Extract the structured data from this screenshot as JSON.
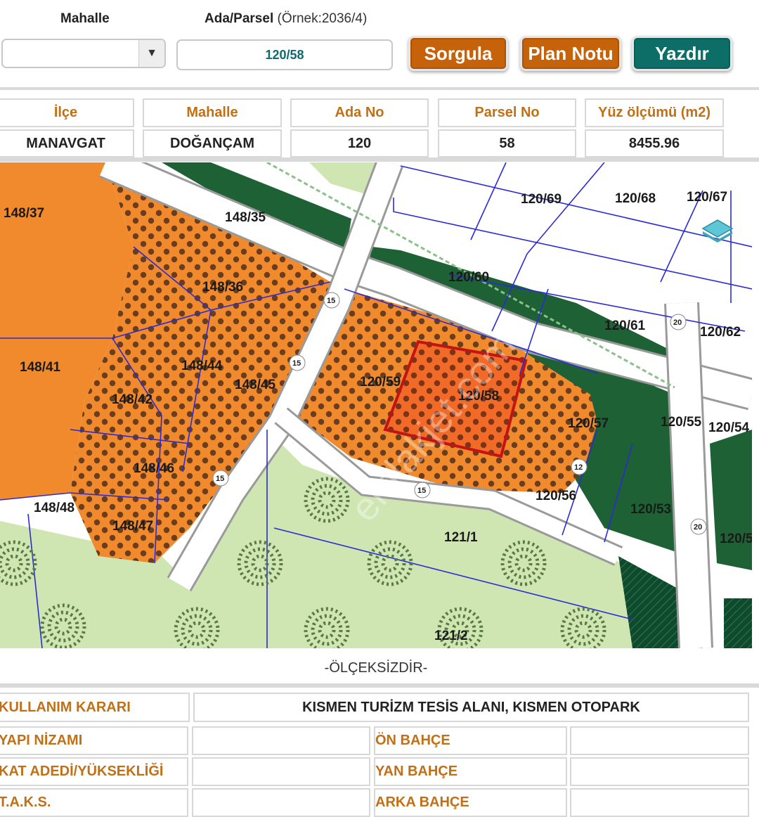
{
  "form": {
    "mahalle_label": "Mahalle",
    "adaparsel_label": "Ada/Parsel",
    "adaparsel_hint": "(Örnek:2036/4)",
    "mahalle_value": "",
    "adaparsel_value": "120/58",
    "buttons": {
      "query": "Sorgula",
      "plan_note": "Plan Notu",
      "print": "Yazdır"
    },
    "colors": {
      "orange": "#c6620a",
      "teal": "#0c6e66",
      "header_text": "#c27016"
    }
  },
  "info_table": {
    "headers": [
      "İlçe",
      "Mahalle",
      "Ada No",
      "Parsel No",
      "Yüz ölçümü (m2)"
    ],
    "values": [
      "MANAVGAT",
      "DOĞANÇAM",
      "120",
      "58",
      "8455.96"
    ]
  },
  "map": {
    "parcel_labels": [
      "148/37",
      "148/36",
      "148/35",
      "148/41",
      "148/44",
      "148/45",
      "148/42",
      "148/46",
      "148/48",
      "148/47",
      "120/69",
      "120/68",
      "120/67",
      "120/60",
      "120/61",
      "120/62",
      "120/59",
      "120/58",
      "120/57",
      "120/55",
      "120/54",
      "120/56",
      "120/53",
      "121/1",
      "121/2",
      "120/5"
    ],
    "highlighted_parcel": "120/58",
    "watermark": "emlakjet.com",
    "road_markers": [
      "15",
      "15",
      "15",
      "15",
      "20",
      "20",
      "12"
    ],
    "layers_icon": "layers-icon"
  },
  "scale_note": "-ÖLÇEKSİZDİR-",
  "plan_table": {
    "kullanim_karari_label": "KULLANIM KARARI",
    "kullanim_karari_value": "KISMEN TURİZM TESİS ALANI, KISMEN OTOPARK",
    "yapi_nizami_label": "YAPI NİZAMI",
    "yapi_nizami_value": "",
    "on_bahce_label": "ÖN BAHÇE",
    "on_bahce_value": "",
    "kat_adedi_label": "KAT ADEDİ/YÜKSEKLİĞİ",
    "kat_adedi_value": "",
    "yan_bahce_label": "YAN BAHÇE",
    "yan_bahce_value": "",
    "taks_label": "T.A.K.S.",
    "taks_value": "",
    "arka_bahce_label": "ARKA BAHÇE",
    "arka_bahce_value": ""
  }
}
